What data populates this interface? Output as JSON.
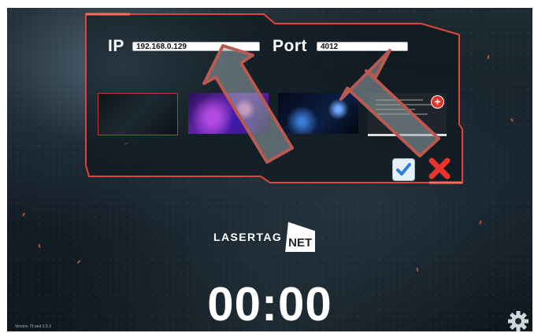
{
  "connection": {
    "ip_label": "IP",
    "ip_value": "192.168.0.129",
    "port_label": "Port",
    "port_value": "4012"
  },
  "backgrounds": {
    "add_icon": "+",
    "thumbnails": [
      "dark-smoke",
      "purple-nebula",
      "blue-galaxy",
      "screenshot"
    ]
  },
  "actions": {
    "confirm_icon": "checkmark-icon",
    "cancel_icon": "close-x-icon"
  },
  "brand": {
    "left": "LASERTAG",
    "right": "NET"
  },
  "timer": "00:00",
  "version": "Version 79 and 2.9.3",
  "colors": {
    "frame": "#e0443a",
    "highlight_arrow": "#b85a52"
  }
}
